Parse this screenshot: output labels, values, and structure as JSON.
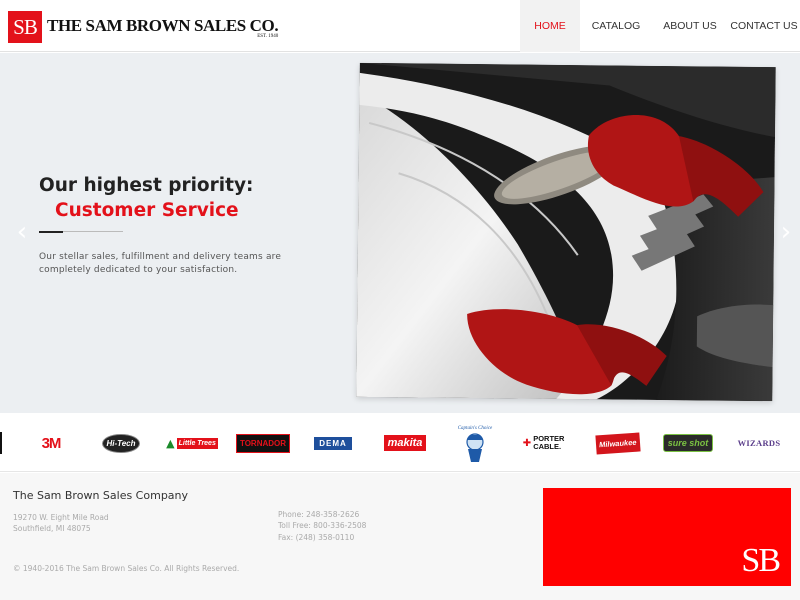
{
  "header": {
    "logo_mark": "SB",
    "logo_name": "THE SAM BROWN SALES CO.",
    "logo_est": "EST. 1940"
  },
  "nav": {
    "items": [
      {
        "label": "HOME",
        "active": true
      },
      {
        "label": "CATALOG",
        "active": false
      },
      {
        "label": "ABOUT US",
        "active": false
      },
      {
        "label": "CONTACT US",
        "active": false
      }
    ]
  },
  "hero": {
    "headline": "Our highest priority:",
    "subheadline": "Customer Service",
    "description": "Our stellar sales, fulfillment and delivery teams are completely dedicated to your satisfaction.",
    "prev_arrow": "‹",
    "next_arrow": "›"
  },
  "brands": {
    "logos": [
      {
        "name": "3M",
        "text": "3M"
      },
      {
        "name": "Hi-Tech",
        "text": "Hi-Tech"
      },
      {
        "name": "Little Trees",
        "text": "Little Trees"
      },
      {
        "name": "Tornador",
        "text": "TORNADOR"
      },
      {
        "name": "DEMA",
        "text": "DEMA"
      },
      {
        "name": "Makita",
        "text": "makita"
      },
      {
        "name": "Captain's Choice",
        "text": "Captain's Choice"
      },
      {
        "name": "Porter Cable",
        "text": "PORTER CABLE."
      },
      {
        "name": "Milwaukee",
        "text": "Milwaukee"
      },
      {
        "name": "Sure Shot",
        "text": "sure shot"
      },
      {
        "name": "Wizards",
        "text": "WIZARDS"
      }
    ]
  },
  "footer": {
    "company": "The Sam Brown Sales Company",
    "address_line1": "19270 W. Eight Mile Road",
    "address_line2": "Southfield, MI 48075",
    "phone": "Phone: 248-358-2626",
    "toll_free": "Toll Free: 800-336-2508",
    "fax": "Fax: (248) 358-0110",
    "copyright": "© 1940-2016 The Sam Brown Sales Co. All Rights Reserved.",
    "box_mark": "SB"
  },
  "colors": {
    "brand_red": "#e3111a",
    "footer_box": "#ff0000",
    "hero_bg": "#eceff2"
  }
}
